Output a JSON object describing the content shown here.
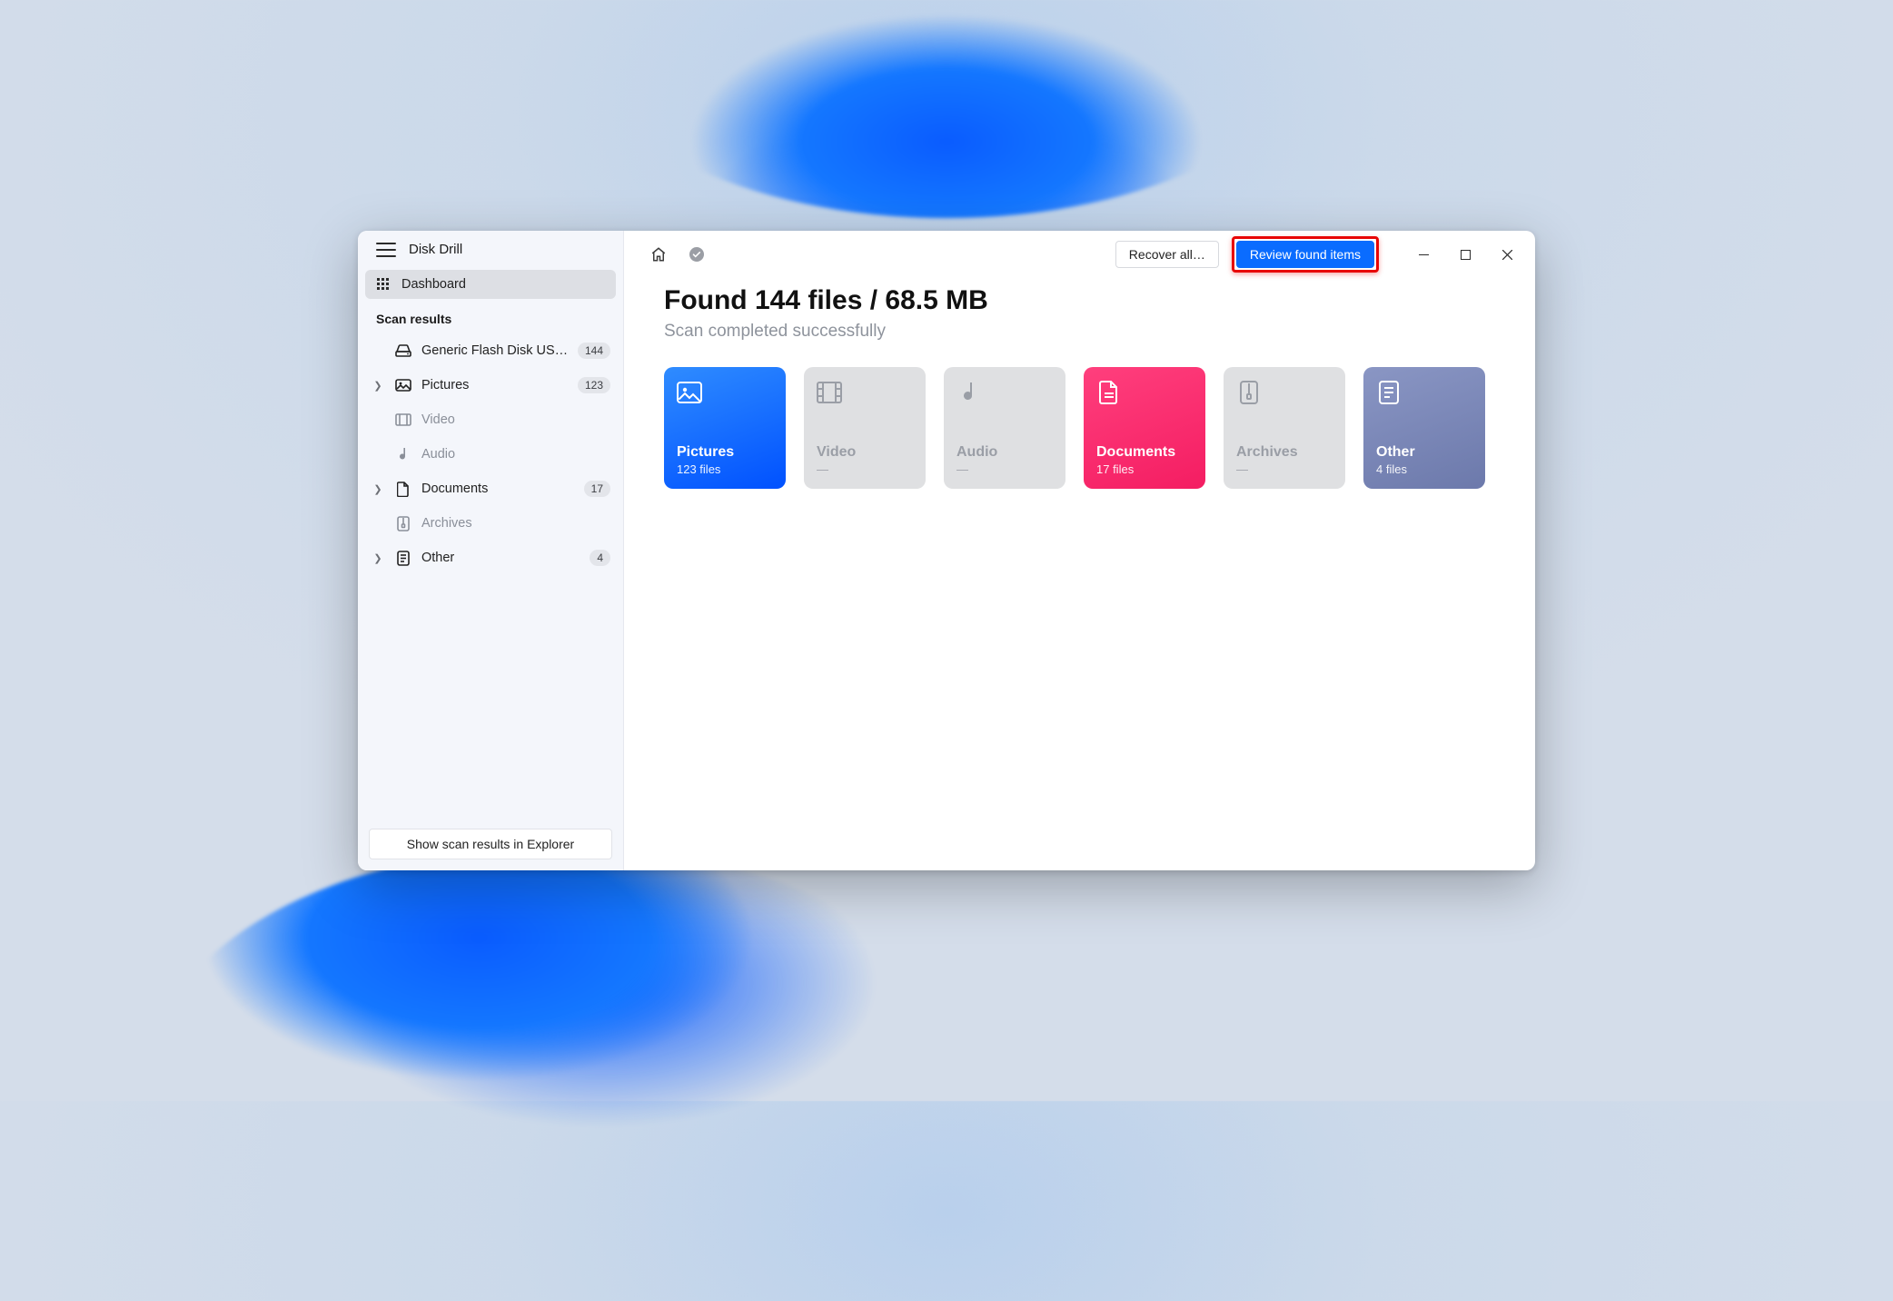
{
  "app": {
    "title": "Disk Drill"
  },
  "sidebar": {
    "dashboard_label": "Dashboard",
    "section_label": "Scan results",
    "items": [
      {
        "label": "Generic Flash Disk USB…",
        "count": "144",
        "icon": "drive",
        "chev": "",
        "dim": false
      },
      {
        "label": "Pictures",
        "count": "123",
        "icon": "picture",
        "chev": ">",
        "dim": false
      },
      {
        "label": "Video",
        "count": "",
        "icon": "video",
        "chev": "",
        "dim": true
      },
      {
        "label": "Audio",
        "count": "",
        "icon": "audio",
        "chev": "",
        "dim": true
      },
      {
        "label": "Documents",
        "count": "17",
        "icon": "doc",
        "chev": ">",
        "dim": false
      },
      {
        "label": "Archives",
        "count": "",
        "icon": "archive",
        "chev": "",
        "dim": true
      },
      {
        "label": "Other",
        "count": "4",
        "icon": "other",
        "chev": ">",
        "dim": false
      }
    ],
    "footer_button": "Show scan results in Explorer"
  },
  "topbar": {
    "recover_all_label": "Recover all…",
    "review_label": "Review found items"
  },
  "main": {
    "headline": "Found 144 files / 68.5 MB",
    "subline": "Scan completed successfully",
    "cards": {
      "pictures": {
        "title": "Pictures",
        "sub": "123 files"
      },
      "video": {
        "title": "Video",
        "sub": "—"
      },
      "audio": {
        "title": "Audio",
        "sub": "—"
      },
      "documents": {
        "title": "Documents",
        "sub": "17 files"
      },
      "archives": {
        "title": "Archives",
        "sub": "—"
      },
      "other": {
        "title": "Other",
        "sub": "4 files"
      }
    }
  }
}
